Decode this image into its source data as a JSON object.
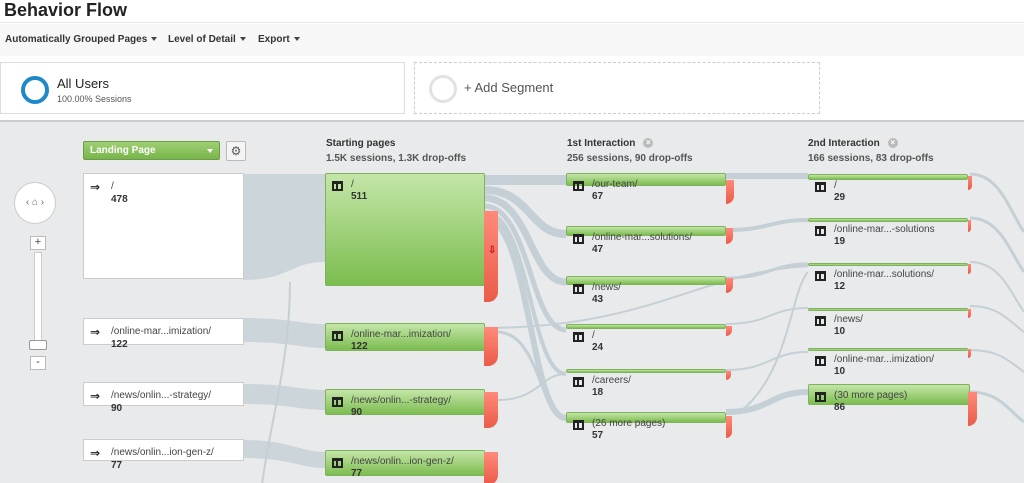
{
  "page": {
    "title": "Behavior Flow"
  },
  "toolbar": {
    "grouped": "Automatically Grouped Pages",
    "detail": "Level of Detail",
    "export": "Export"
  },
  "segments": {
    "all_users": "All Users",
    "all_users_pct": "100.00% Sessions",
    "add_segment": "+ Add Segment"
  },
  "colors": {
    "node_green": "#7cbd50",
    "dropoff_red": "#ea5c48",
    "segment_blue": "#1e88c9"
  },
  "dimension": {
    "selected": "Landing Page"
  },
  "columns": {
    "starting": {
      "title": "Starting pages",
      "summary": "1.5K sessions, 1.3K drop-offs"
    },
    "first": {
      "title": "1st Interaction",
      "summary": "256 sessions, 90 drop-offs"
    },
    "second": {
      "title": "2nd Interaction",
      "summary": "166 sessions, 83 drop-offs"
    }
  },
  "landing_pages": [
    {
      "name": "/",
      "count": "478"
    },
    {
      "name": "/online-mar...imization/",
      "count": "122"
    },
    {
      "name": "/news/onlin...-strategy/",
      "count": "90"
    },
    {
      "name": "/news/onlin...ion-gen-z/",
      "count": "77"
    }
  ],
  "starting_nodes": [
    {
      "name": "/",
      "count": "511"
    },
    {
      "name": "/online-mar...imization/",
      "count": "122"
    },
    {
      "name": "/news/onlin...-strategy/",
      "count": "90"
    },
    {
      "name": "/news/onlin...ion-gen-z/",
      "count": "77"
    }
  ],
  "first_nodes": [
    {
      "name": "/our-team/",
      "count": "67"
    },
    {
      "name": "/online-mar...solutions/",
      "count": "47"
    },
    {
      "name": "/news/",
      "count": "43"
    },
    {
      "name": "/",
      "count": "24"
    },
    {
      "name": "/careers/",
      "count": "18"
    },
    {
      "name": "(26 more pages)",
      "count": "57"
    }
  ],
  "second_nodes": [
    {
      "name": "/",
      "count": "29"
    },
    {
      "name": "/online-mar...-solutions",
      "count": "19"
    },
    {
      "name": "/online-mar...solutions/",
      "count": "12"
    },
    {
      "name": "/news/",
      "count": "10"
    },
    {
      "name": "/online-mar...imization/",
      "count": "10"
    },
    {
      "name": "(30 more pages)",
      "count": "86"
    }
  ]
}
